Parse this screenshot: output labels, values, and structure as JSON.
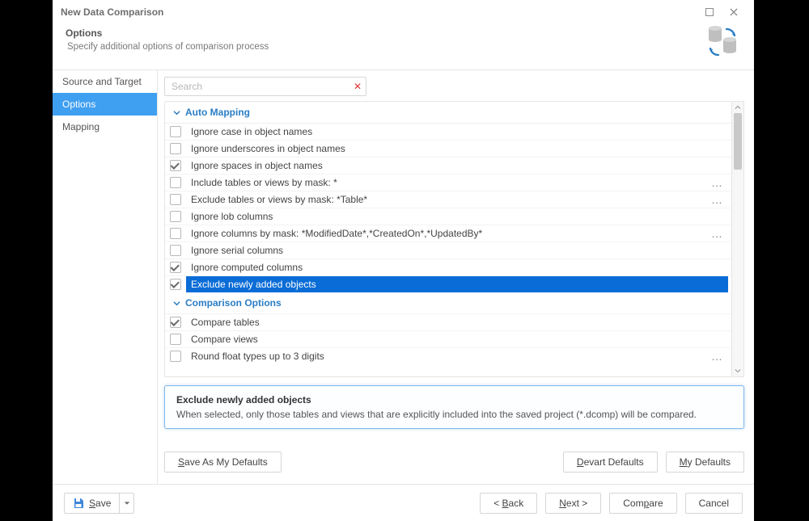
{
  "window": {
    "title": "New Data Comparison"
  },
  "header": {
    "title": "Options",
    "subtitle": "Specify additional options of comparison process"
  },
  "sidebar": {
    "items": [
      {
        "label": "Source and Target",
        "active": false
      },
      {
        "label": "Options",
        "active": true
      },
      {
        "label": "Mapping",
        "active": false
      }
    ]
  },
  "search": {
    "placeholder": "Search"
  },
  "groups": [
    {
      "title": "Auto Mapping",
      "options": [
        {
          "label": "Ignore case in object names",
          "checked": false
        },
        {
          "label": "Ignore underscores in object names",
          "checked": false
        },
        {
          "label": "Ignore spaces in object names",
          "checked": true
        },
        {
          "label": "Include tables or views by mask: *",
          "checked": false,
          "ellipsis": true
        },
        {
          "label": "Exclude tables or views by mask: *Table*",
          "checked": false,
          "ellipsis": true
        },
        {
          "label": "Ignore lob columns",
          "checked": false
        },
        {
          "label": "Ignore columns by mask: *ModifiedDate*,*CreatedOn*,*UpdatedBy*",
          "checked": false,
          "ellipsis": true
        },
        {
          "label": "Ignore serial columns",
          "checked": false
        },
        {
          "label": "Ignore computed columns",
          "checked": true
        },
        {
          "label": "Exclude newly added objects",
          "checked": true,
          "selected": true
        }
      ]
    },
    {
      "title": "Comparison Options",
      "options": [
        {
          "label": "Compare tables",
          "checked": true
        },
        {
          "label": "Compare views",
          "checked": false
        },
        {
          "label": "Round float types up to 3 digits",
          "checked": false,
          "ellipsis": true
        }
      ]
    }
  ],
  "description": {
    "title": "Exclude newly added objects",
    "text": "When selected, only those tables and views that are explicitly included into the saved project (*.dcomp) will be compared."
  },
  "buttons": {
    "save_defaults": {
      "key": "S",
      "rest": "ave As My Defaults"
    },
    "devart_defaults": {
      "key": "D",
      "rest": "evart Defaults"
    },
    "my_defaults": {
      "key": "M",
      "rest": "y Defaults"
    },
    "save": {
      "key": "S",
      "rest": "ave"
    },
    "back": {
      "pre": "< ",
      "key": "B",
      "rest": "ack"
    },
    "next": {
      "key": "N",
      "rest": "ext >"
    },
    "compare": {
      "pre": "Com",
      "key": "p",
      "rest": "are"
    },
    "cancel": {
      "label": "Cancel"
    }
  },
  "colors": {
    "accent": "#2a7dc4",
    "selection": "#0a6cd6",
    "sidebar_active": "#3f9ff1"
  }
}
